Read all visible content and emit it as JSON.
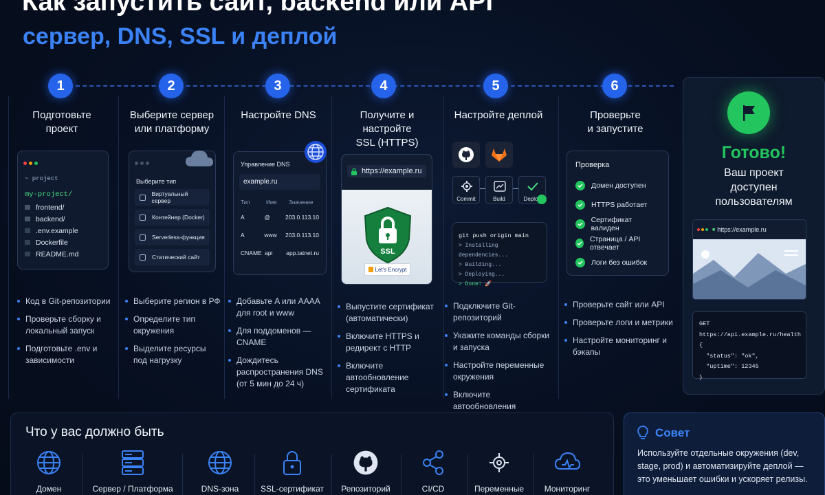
{
  "header": {
    "title": "Как запустить сайт, backend или API",
    "subtitle": "сервер, DNS, SSL и деплой"
  },
  "steps": [
    {
      "num": "1",
      "title_l1": "Подготовьте",
      "title_l2": "проект",
      "bullets": [
        "Код в Git-репозитории",
        "Проверьте сборку и локальный запуск",
        "Подготовьте .env и зависимости"
      ]
    },
    {
      "num": "2",
      "title_l1": "Выберите сервер",
      "title_l2": "или платформу",
      "bullets": [
        "Выберите регион в РФ",
        "Определите тип окружения",
        "Выделите ресурсы под нагрузку"
      ]
    },
    {
      "num": "3",
      "title_l1": "Настройте DNS",
      "title_l2": "",
      "bullets": [
        "Добавьте A или AAAA для root и www",
        "Для поддоменов — CNAME",
        "Дождитесь распространения DNS (от 5 мин до 24 ч)"
      ]
    },
    {
      "num": "4",
      "title_l1": "Получите и настройте",
      "title_l2": "SSL (HTTPS)",
      "bullets": [
        "Выпустите сертификат (автоматически)",
        "Включите HTTPS и редирект с HTTP",
        "Включите автообновление сертификата"
      ]
    },
    {
      "num": "5",
      "title_l1": "Настройте деплой",
      "title_l2": "",
      "bullets": [
        "Подключите Git-репозиторий",
        "Укажите команды сборки и запуска",
        "Настройте переменные окружения",
        "Включите автообновления"
      ]
    },
    {
      "num": "6",
      "title_l1": "Проверьте",
      "title_l2": "и запустите",
      "bullets": [
        "Проверьте сайт или API",
        "Проверьте логи и метрики",
        "Настройте мониторинг и бэкапы"
      ]
    }
  ],
  "card1": {
    "header": "~ project",
    "folder": "my-project/",
    "files": [
      "frontend/",
      "backend/",
      ".env.example",
      "Dockerfile",
      "README.md"
    ]
  },
  "card2": {
    "label": "Выберите тип",
    "options": [
      "Виртуальный сервер",
      "Контейнер (Docker)",
      "Serverless-функция",
      "Статический сайт"
    ]
  },
  "card3": {
    "title": "Управление DNS",
    "domain": "example.ru",
    "headers": [
      "Тип",
      "Имя",
      "Значение"
    ],
    "rows": [
      [
        "A",
        "@",
        "203.0.113.10"
      ],
      [
        "A",
        "www",
        "203.0.113.10"
      ],
      [
        "CNAME",
        "api",
        "app.tatnet.ru"
      ]
    ]
  },
  "card4": {
    "url": "https://example.ru",
    "shield_text": "SSL",
    "badge": "Let's Encrypt"
  },
  "card5": {
    "pipeline": [
      "Commit",
      "Build",
      "Deploy"
    ],
    "terminal": [
      "git push origin main",
      "> Installing dependencies...",
      "> Building...",
      "> Deploying...",
      "> Done! 🚀"
    ]
  },
  "card6": {
    "title": "Проверка",
    "checks": [
      "Домен доступен",
      "HTTPS работает",
      "Сертификат валиден",
      "Страница / API отвечает",
      "Логи без ошибок"
    ]
  },
  "done": {
    "title": "Готово!",
    "line1": "Ваш проект",
    "line2": "доступен",
    "line3": "пользователям",
    "url": "https://example.ru",
    "code": [
      "GET https://api.example.ru/health",
      "{",
      "  \"status\": \"ok\",",
      "  \"uptime\": 12345",
      "}"
    ]
  },
  "requirements": {
    "title": "Что у вас должно быть",
    "items": [
      "Домен",
      "Сервер / Платформа",
      "DNS-зона",
      "SSL-сертификат",
      "Репозиторий",
      "CI/CD",
      "Переменные",
      "Мониторинг"
    ]
  },
  "tip": {
    "title": "Совет",
    "text": "Используйте отдельные окружения (dev, stage, prod) и автоматизируйте деплой — это уменьшает ошибки и ускоряет релизы."
  },
  "colors": {
    "accent": "#2563eb",
    "success": "#22c55e",
    "bg": "#071022"
  }
}
